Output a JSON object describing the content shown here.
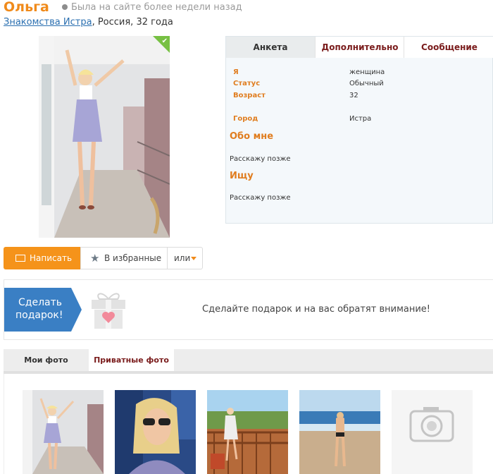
{
  "profile": {
    "name": "Ольга",
    "status": "Была на сайте более недели назад",
    "location_link": "Знакомства Истра",
    "location_rest": ", Россия, 32 года",
    "verified_mark": "✔"
  },
  "tabs": {
    "anketa": "Анкета",
    "dop": "Дополнительно",
    "msg": "Сообщение"
  },
  "fields": {
    "i_label": "Я",
    "i_value": "женщина",
    "status_label": "Статус",
    "status_value": "Обычный",
    "age_label": "Возраст",
    "age_value": "32",
    "city_label": "Город",
    "city_value": "Истра"
  },
  "about": {
    "title": "Обо мне",
    "text": "Расскажу позже"
  },
  "seek": {
    "title": "Ищу",
    "text": "Расскажу позже"
  },
  "actions": {
    "write": "Написать",
    "favorite": "В избранные",
    "or": "или"
  },
  "gift": {
    "button_line1": "Сделать",
    "button_line2": "подарок!",
    "promo": "Сделайте подарок и на вас обратят внимание!"
  },
  "photos": {
    "tab_my": "Мои фото",
    "tab_private": "Приватные фото"
  },
  "colors": {
    "brand_orange": "#f08a1a",
    "link_blue": "#2a6fb0",
    "gift_blue": "#3a7fc4",
    "verified_green": "#77c043"
  }
}
